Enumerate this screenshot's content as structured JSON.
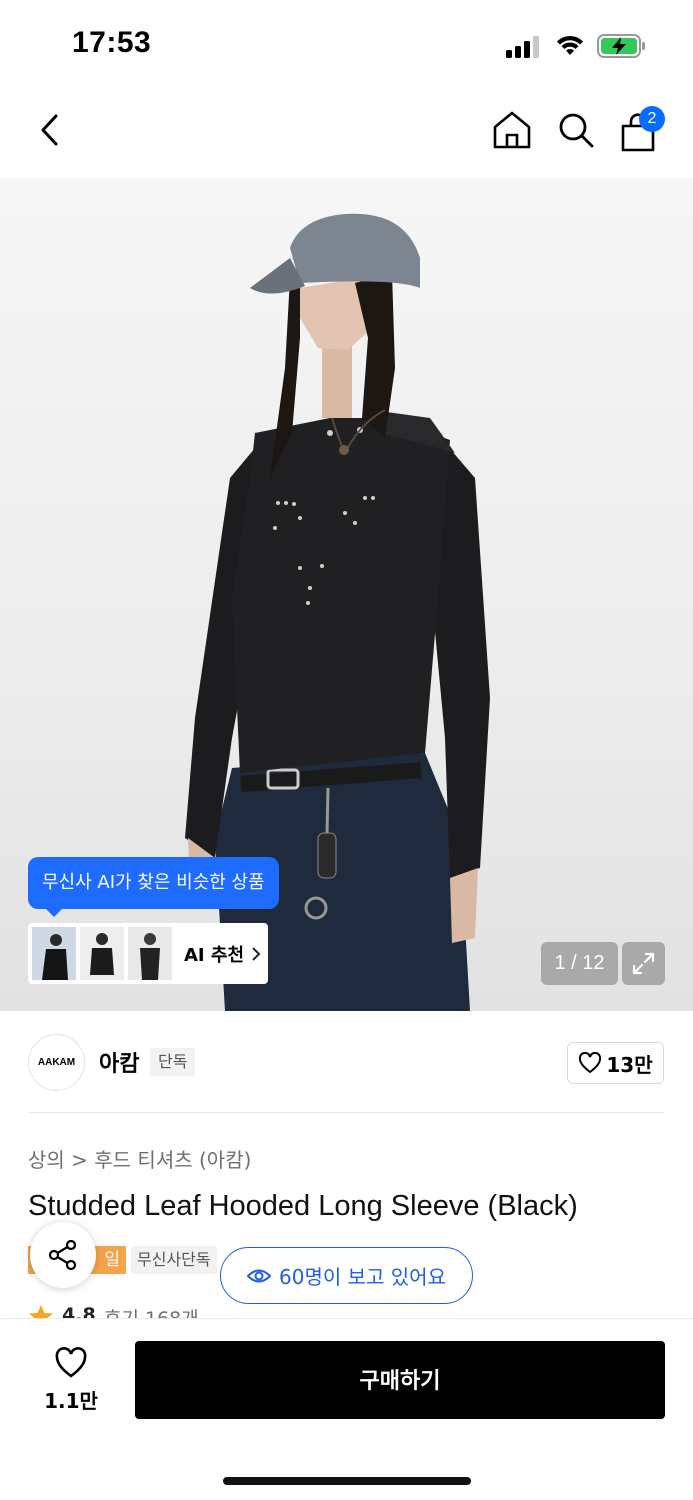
{
  "status_bar": {
    "time": "17:53"
  },
  "nav": {
    "cart_badge": "2"
  },
  "image": {
    "ai_tooltip": "무신사 AI가 찾은 비슷한 상품",
    "ai_recommend_label": "AI 추천",
    "page_counter": "1 / 12"
  },
  "brand": {
    "logo_text": "AAKAM",
    "name": "아캄",
    "exclusive_tag": "단독",
    "like_count": "13만"
  },
  "product": {
    "breadcrumb": "상의 > 후드 티셔츠 (아캄)",
    "title": "Studded Leaf Hooded Long Sleeve (Black)",
    "tag_orange": "일",
    "tag_gray": "무신사단독",
    "viewers": "60명이 보고 있어요",
    "rating": "4.8",
    "review_count": "후기 168개"
  },
  "bottom_bar": {
    "wish_count": "1.1만",
    "buy_label": "구매하기"
  },
  "colors": {
    "accent_blue": "#1e6cff",
    "badge_blue": "#0a6cff",
    "tag_orange": "#f3a34a",
    "buy_button": "#000000"
  }
}
